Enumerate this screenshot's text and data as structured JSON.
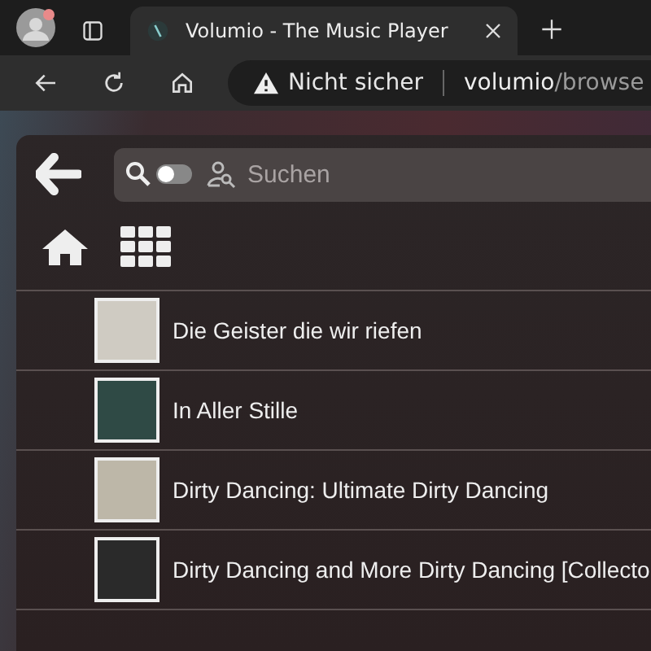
{
  "browser": {
    "tab": {
      "title": "Volumio - The Music Player",
      "selected": true
    },
    "address": {
      "security": "Nicht sicher",
      "host": "volumio",
      "path": "/browse"
    }
  },
  "search": {
    "placeholder": "Suchen",
    "toggle_on": false
  },
  "albums": [
    {
      "title": "Die Geister die wir riefen",
      "color": "#cfcbc2"
    },
    {
      "title": "In Aller Stille",
      "color": "#2f4a45"
    },
    {
      "title": "Dirty Dancing: Ultimate Dirty Dancing",
      "color": "#bdb7a8"
    },
    {
      "title": "Dirty Dancing and More Dirty Dancing [Collecto",
      "color": "#2a2a2a"
    }
  ]
}
